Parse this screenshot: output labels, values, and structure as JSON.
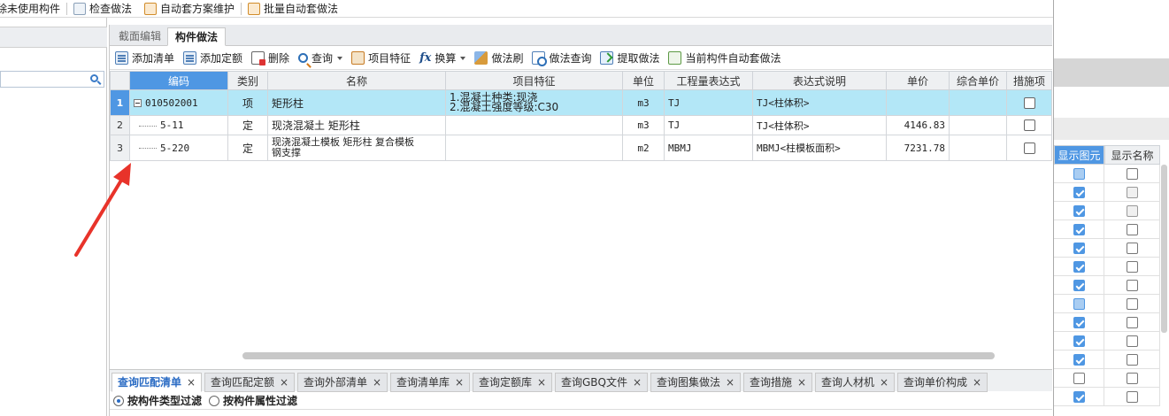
{
  "toolbar": {
    "items": [
      {
        "label": "除未使用构件",
        "icon": "none"
      },
      {
        "label": "检查做法",
        "icon": "check-icon"
      },
      {
        "label": "自动套方案维护",
        "icon": "scheme-icon"
      },
      {
        "label": "批量自动套做法",
        "icon": "batch-icon"
      }
    ]
  },
  "tabs": [
    {
      "label": "截面编辑",
      "active": false
    },
    {
      "label": "构件做法",
      "active": true
    }
  ],
  "actions": {
    "add_list": "添加清单",
    "add_quota": "添加定额",
    "delete": "删除",
    "query": "查询",
    "item_feature": "项目特征",
    "convert": "换算",
    "method_brush": "做法刷",
    "method_query": "做法查询",
    "extract_method": "提取做法",
    "auto_apply": "当前构件自动套做法"
  },
  "grid": {
    "columns": [
      "编码",
      "类别",
      "名称",
      "项目特征",
      "单位",
      "工程量表达式",
      "表达式说明",
      "单价",
      "综合单价",
      "措施项"
    ],
    "rows": [
      {
        "num": "1",
        "code": "010502001",
        "type": "项",
        "name": "矩形柱",
        "feature_line1": "1.混凝土种类:现浇",
        "feature_line2": "2.混凝土强度等级:C30",
        "unit": "m3",
        "expr": "TJ",
        "expr_desc": "TJ<柱体积>",
        "price": "",
        "combined": ""
      },
      {
        "num": "2",
        "code": "5-11",
        "type": "定",
        "name": "现浇混凝土 矩形柱",
        "unit": "m3",
        "expr": "TJ",
        "expr_desc": "TJ<柱体积>",
        "price": "4146.83",
        "combined": ""
      },
      {
        "num": "3",
        "code": "5-220",
        "type": "定",
        "name_line1": "现浇混凝土模板 矩形柱 复合模板",
        "name_line2": "钢支撑",
        "unit": "m2",
        "expr": "MBMJ",
        "expr_desc": "MBMJ<柱模板面积>",
        "price": "7231.78",
        "combined": ""
      }
    ]
  },
  "bottom_tabs": [
    {
      "label": "查询匹配清单",
      "active": true
    },
    {
      "label": "查询匹配定额",
      "active": false
    },
    {
      "label": "查询外部清单",
      "active": false
    },
    {
      "label": "查询清单库",
      "active": false
    },
    {
      "label": "查询定额库",
      "active": false
    },
    {
      "label": "查询GBQ文件",
      "active": false
    },
    {
      "label": "查询图集做法",
      "active": false
    },
    {
      "label": "查询措施",
      "active": false
    },
    {
      "label": "查询人材机",
      "active": false
    },
    {
      "label": "查询单价构成",
      "active": false
    }
  ],
  "close_glyph": "×",
  "filters": {
    "by_type": "按构件类型过滤",
    "by_attr": "按构件属性过滤",
    "selected": "by_type"
  },
  "right_panel": {
    "col_show_element": "显示图元",
    "col_show_name": "显示名称",
    "rows": [
      {
        "element": "partial",
        "name": "unchecked"
      },
      {
        "element": "checked",
        "name": "disabled"
      },
      {
        "element": "checked",
        "name": "disabled"
      },
      {
        "element": "checked",
        "name": "unchecked"
      },
      {
        "element": "checked",
        "name": "unchecked"
      },
      {
        "element": "checked",
        "name": "unchecked"
      },
      {
        "element": "checked",
        "name": "unchecked"
      },
      {
        "element": "partial",
        "name": "unchecked"
      },
      {
        "element": "checked",
        "name": "unchecked"
      },
      {
        "element": "checked",
        "name": "unchecked"
      },
      {
        "element": "checked",
        "name": "unchecked"
      },
      {
        "element": "unchecked",
        "name": "unchecked"
      },
      {
        "element": "checked",
        "name": "unchecked"
      }
    ]
  },
  "colors": {
    "selection_blue": "#4f97e3",
    "row_highlight": "#b3e7f7",
    "annotation_arrow": "#e8332a",
    "active_tab_text": "#2b6cc4"
  }
}
